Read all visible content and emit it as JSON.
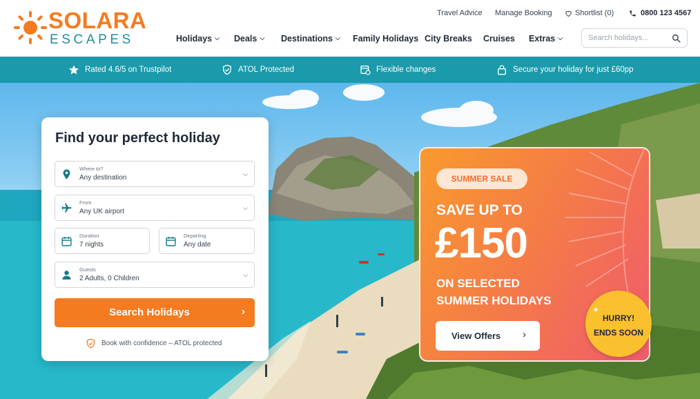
{
  "brand": {
    "name_top": "SOLARA",
    "name_bottom": "ESCAPES",
    "primary_color": "#f47b20",
    "secondary_color": "#1b8e9c"
  },
  "utility_nav": {
    "travel_advice": "Travel Advice",
    "manage_booking": "Manage Booking",
    "shortlist": "Shortlist (0)",
    "phone": "0800 123 4567"
  },
  "main_nav": [
    {
      "label": "Holidays",
      "dropdown": true
    },
    {
      "label": "Deals",
      "dropdown": true
    },
    {
      "label": "Destinations",
      "dropdown": true
    },
    {
      "label": "Family Holidays",
      "dropdown": false
    },
    {
      "label": "City Breaks",
      "dropdown": false
    },
    {
      "label": "Cruises",
      "dropdown": false
    },
    {
      "label": "Extras",
      "dropdown": true
    }
  ],
  "search": {
    "placeholder": "Search holidays..."
  },
  "trust_bar": {
    "color": "#1a9aaa",
    "items": [
      {
        "icon": "star-icon",
        "text": "Rated 4.6/5 on Trustpilot"
      },
      {
        "icon": "shield-check-icon",
        "text": "ATOL Protected"
      },
      {
        "icon": "calendar-refresh-icon",
        "text": "Flexible changes"
      },
      {
        "icon": "lock-icon",
        "text": "Secure your holiday for just £60pp"
      }
    ]
  },
  "search_card": {
    "title": "Find your perfect holiday",
    "where": {
      "label": "Where to?",
      "value": "Any destination",
      "icon": "map-pin-icon"
    },
    "from": {
      "label": "From",
      "value": "Any UK airport",
      "icon": "plane-icon"
    },
    "duration": {
      "label": "Duration",
      "value": "7 nights",
      "icon": "calendar-icon"
    },
    "departing": {
      "label": "Departing",
      "value": "Any date",
      "icon": "calendar-icon"
    },
    "guests": {
      "label": "Guests",
      "value": "2 Adults, 0 Children",
      "icon": "person-icon"
    },
    "cta": "Search Holidays",
    "confidence": "Book with confidence – ATOL protected"
  },
  "promo": {
    "badge": "SUMMER SALE",
    "line1": "SAVE UP TO",
    "amount": "£150",
    "line2": "ON SELECTED",
    "line3": "SUMMER HOLIDAYS",
    "button": "View Offers",
    "hurry_line1": "HURRY!",
    "hurry_line2": "ENDS SOON"
  }
}
